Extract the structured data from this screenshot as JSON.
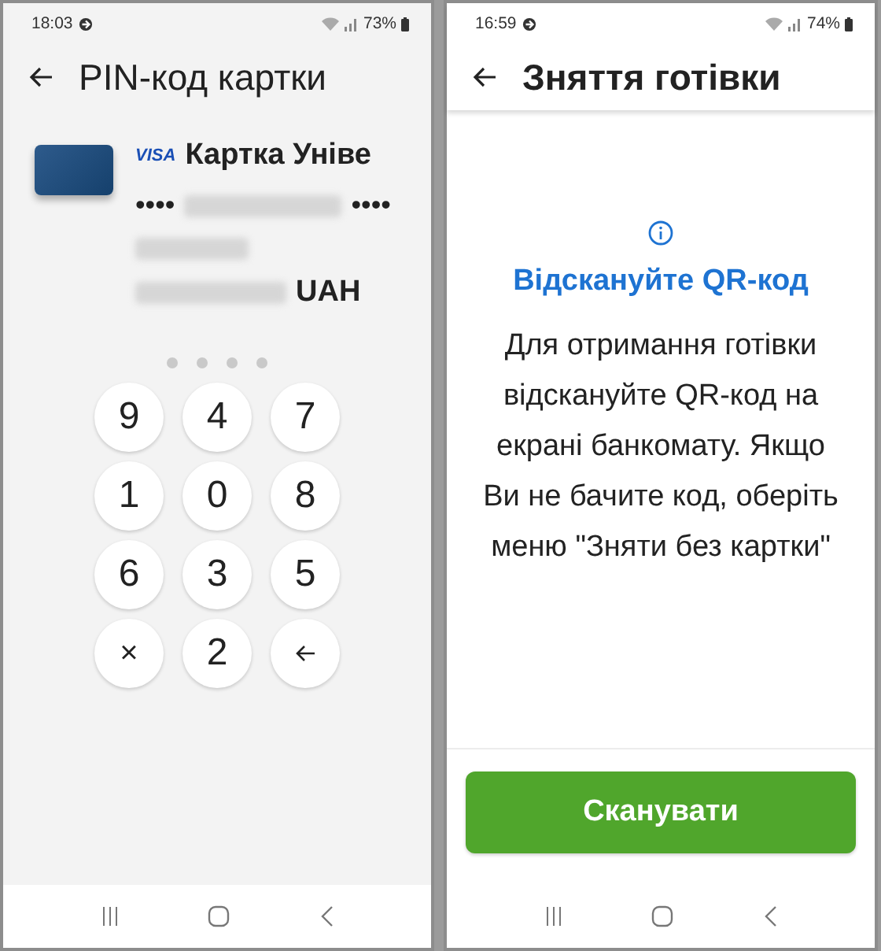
{
  "screens": [
    {
      "kind": "pin",
      "status_bar": {
        "time": "18:03",
        "battery": "73%"
      },
      "title": "PIN-код картки",
      "card": {
        "brand": "VISA",
        "name": "Картка Уніве",
        "masked_prefix": "••••",
        "masked_suffix": "••••",
        "currency": "UAH"
      },
      "pin_dots": [
        {
          "filled": false
        },
        {
          "filled": false
        },
        {
          "filled": false
        },
        {
          "filled": false
        }
      ],
      "keypad": [
        {
          "kind": "digit",
          "label": "9"
        },
        {
          "kind": "digit",
          "label": "4"
        },
        {
          "kind": "digit",
          "label": "7"
        },
        {
          "kind": "digit",
          "label": "1"
        },
        {
          "kind": "digit",
          "label": "0"
        },
        {
          "kind": "digit",
          "label": "8"
        },
        {
          "kind": "digit",
          "label": "6"
        },
        {
          "kind": "digit",
          "label": "3"
        },
        {
          "kind": "digit",
          "label": "5"
        },
        {
          "kind": "clear",
          "label": "×"
        },
        {
          "kind": "digit",
          "label": "2"
        },
        {
          "kind": "backspace"
        }
      ]
    },
    {
      "kind": "qr",
      "status_bar": {
        "time": "16:59",
        "battery": "74%"
      },
      "title": "Зняття готівки",
      "heading": "Відскануйте QR-код",
      "message": "Для отримання готівки відскануйте QR-код на екрані банкомату. Якщо Ви не бачите код, оберіть меню \"Зняти без картки\"",
      "button": "Сканувати"
    }
  ]
}
